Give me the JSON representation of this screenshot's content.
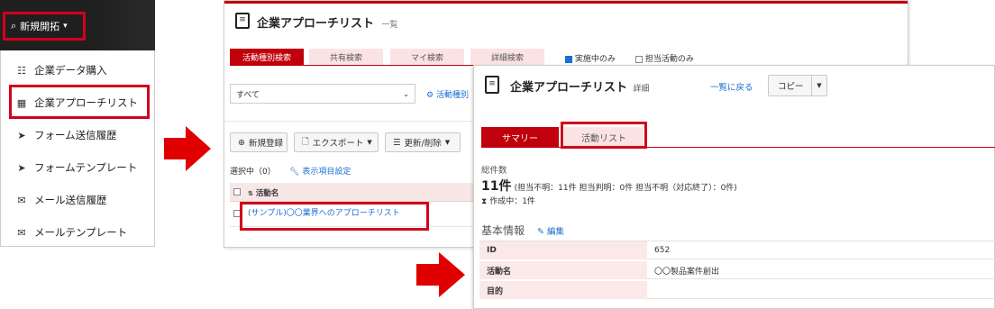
{
  "panel1": {
    "new_button": "新規開拓",
    "caret": "▾",
    "menu": [
      {
        "label": "企業データ購入",
        "icon": "list-search-icon"
      },
      {
        "label": "企業アプローチリスト",
        "icon": "building-icon"
      },
      {
        "label": "フォーム送信履歴",
        "icon": "paper-plane-icon"
      },
      {
        "label": "フォームテンプレート",
        "icon": "paper-plane-icon"
      },
      {
        "label": "メール送信履歴",
        "icon": "envelope-icon"
      },
      {
        "label": "メールテンプレート",
        "icon": "envelope-icon"
      }
    ]
  },
  "panel2": {
    "title": "企業アプローチリスト",
    "subtitle": "一覧",
    "tabs": [
      "活動種別検索",
      "共有検索",
      "マイ検索",
      "詳細検索"
    ],
    "filter_active": "実施中のみ",
    "filter_mine": "担当活動のみ",
    "select_value": "すべて",
    "settings_link": "活動種別",
    "btn_new": "新規登録",
    "btn_export": "エクスポート",
    "btn_update": "更新/削除",
    "selected_count": "選択中（0）",
    "display_settings": "表示項目設定",
    "col_name": "活動名",
    "row_link": "(サンプル)〇〇業界へのアプローチリスト"
  },
  "panel3": {
    "title": "企業アプローチリスト",
    "subtitle": "詳細",
    "back_link": "一覧に戻る",
    "copy_button": "コピー",
    "tab_summary": "サマリー",
    "tab_list": "活動リスト",
    "total_label": "総件数",
    "total_value": "11件",
    "total_detail": "(担当不明：11件 担当判明：0件 担当不明（対応終了）：0件)",
    "in_progress": "作成中：1件",
    "section_title": "基本情報",
    "edit_link": "編集",
    "rows": [
      {
        "key": "ID",
        "value": "652"
      },
      {
        "key": "活動名",
        "value": "〇〇製品案件創出"
      },
      {
        "key": "目的",
        "value": ""
      }
    ]
  },
  "colors": {
    "accent": "#d0021b",
    "tab_active": "#c0000a",
    "link": "#1a6fd1"
  }
}
